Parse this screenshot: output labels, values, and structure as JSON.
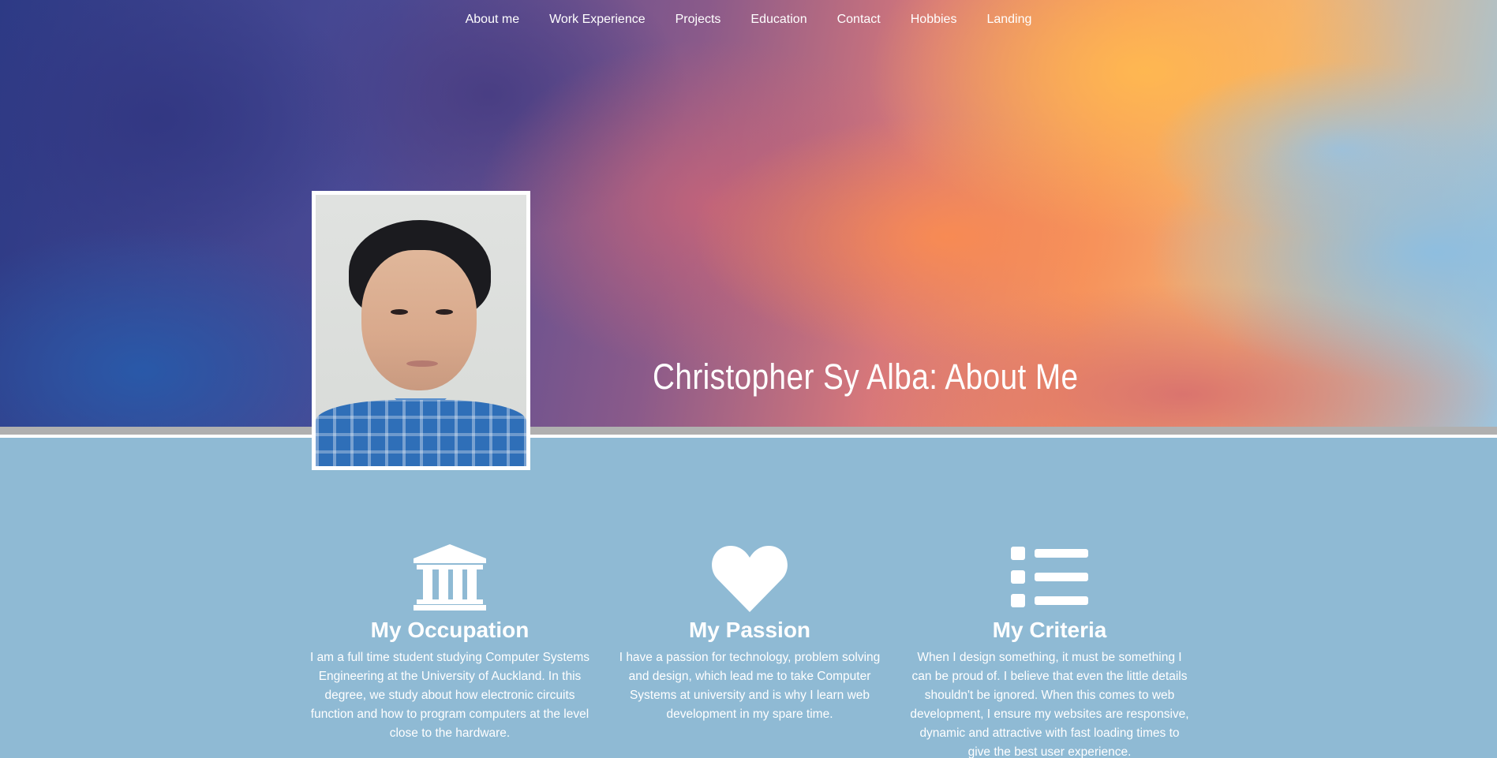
{
  "nav": {
    "items": [
      {
        "label": "About me"
      },
      {
        "label": "Work Experience"
      },
      {
        "label": "Projects"
      },
      {
        "label": "Education"
      },
      {
        "label": "Contact"
      },
      {
        "label": "Hobbies"
      },
      {
        "label": "Landing"
      }
    ]
  },
  "hero": {
    "title": "Christopher Sy Alba: About Me"
  },
  "features": [
    {
      "icon": "university-icon",
      "title": "My Occupation",
      "text": "I am a full time student studying Computer Systems Engineering at the University of Auckland. In this degree, we study about how electronic circuits function and how to program computers at the level close to the hardware."
    },
    {
      "icon": "heart-icon",
      "title": "My Passion",
      "text": "I have a passion for technology, problem solving and design, which lead me to take Computer Systems at university and is why I learn web development in my spare time."
    },
    {
      "icon": "list-icon",
      "title": "My Criteria",
      "text": "When I design something, it must be something I can be proud of. I believe that even the little details shouldn't be ignored. When this comes to web development, I ensure my websites are responsive, dynamic and attractive with fast loading times to give the best user experience."
    }
  ],
  "colors": {
    "section_bg": "#8fbad4",
    "text": "#ffffff",
    "divider": "#b0b0b0"
  }
}
